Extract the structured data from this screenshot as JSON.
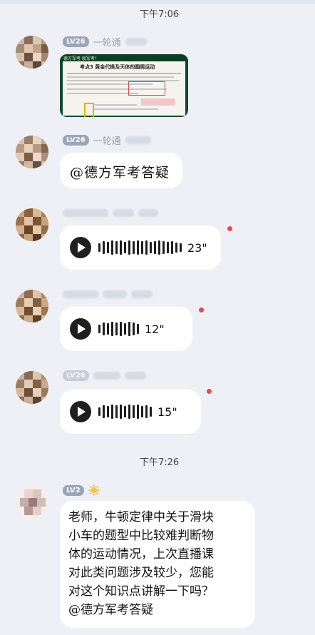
{
  "timestamps": [
    "下午7:06",
    "下午7:26"
  ],
  "messages": [
    {
      "level": "LV26",
      "sender_visible": "一轮通",
      "type": "image",
      "image": {
        "header_left": "德方军考 就军考！",
        "title": "考点3 黄金代换及天体的圆周运动"
      }
    },
    {
      "level": "LV26",
      "sender_visible": "一轮通",
      "type": "text",
      "text": "@德方军考答疑"
    },
    {
      "type": "voice",
      "duration": "23\""
    },
    {
      "type": "voice",
      "duration": "12\""
    },
    {
      "level": "LV26",
      "type": "voice",
      "duration": "15\""
    },
    {
      "level": "LV2",
      "type": "text",
      "lines": [
        "老师，牛顿定律中关于滑块",
        "小车的题型中比较难判断物",
        "体的运动情况，上次直播课",
        "对此类问题涉及较少，您能",
        "对这个知识点讲解一下吗？",
        "@德方军考答疑"
      ]
    }
  ],
  "colors": {
    "background": "#eef0f6",
    "bubble": "#ffffff",
    "unread_dot": "#e84a4a",
    "level_badge": "#9aa5b8"
  },
  "icons": {
    "play": "play-icon",
    "sun": "sun-icon"
  }
}
